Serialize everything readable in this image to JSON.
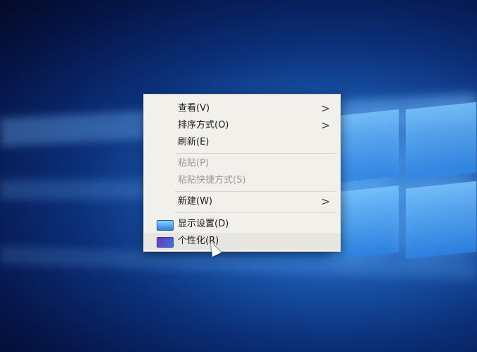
{
  "context_menu": {
    "items": [
      {
        "label": "查看(V)",
        "submenu_glyph": ">"
      },
      {
        "label": "排序方式(O)",
        "submenu_glyph": ">"
      },
      {
        "label": "刷新(E)"
      },
      {
        "label": "粘贴(P)",
        "disabled": true
      },
      {
        "label": "粘贴快捷方式(S)",
        "disabled": true
      },
      {
        "label": "新建(W)",
        "submenu_glyph": ">"
      },
      {
        "label": "显示设置(D)",
        "icon": "display-settings-icon"
      },
      {
        "label": "个性化(R)",
        "icon": "personalize-icon"
      }
    ]
  },
  "colors": {
    "menu_background": "#f1f0ea",
    "desktop_blue": "#1d5fb8",
    "disabled_text": "#9a9a9a"
  }
}
